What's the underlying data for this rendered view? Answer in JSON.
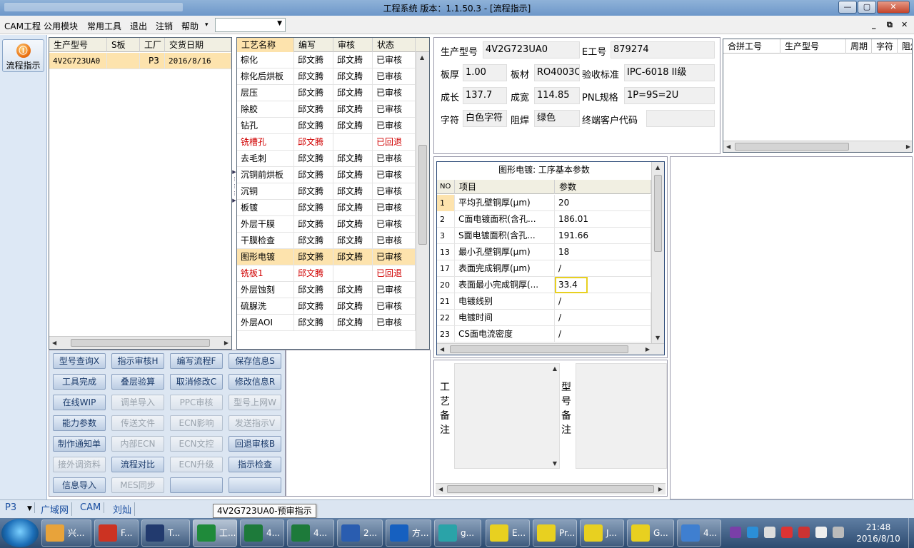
{
  "window": {
    "title": "工程系统    版本：1.1.50.3 - [流程指示]",
    "controls": [
      "—",
      "▢",
      "✕"
    ]
  },
  "menu": {
    "items": [
      "CAM工程",
      "公用模块",
      "常用工具",
      "退出",
      "注销",
      "帮助",
      "▾"
    ],
    "combo_value": "",
    "mdi_controls": [
      "_",
      "⧉",
      "✕"
    ]
  },
  "side": {
    "flow_button": "流程指示",
    "flow_icon": "Ⓘ"
  },
  "orders": {
    "columns": [
      "生产型号",
      "S板",
      "工厂",
      "交货日期"
    ],
    "rows": [
      [
        "4V2G723UA0",
        "",
        "P3",
        "2016/8/16"
      ]
    ]
  },
  "process": {
    "columns": [
      "工艺名称",
      "编写",
      "审核",
      "状态"
    ],
    "rows": [
      [
        "棕化",
        "邱文腾",
        "邱文腾",
        "已审核"
      ],
      [
        "棕化后烘板",
        "邱文腾",
        "邱文腾",
        "已审核"
      ],
      [
        "层压",
        "邱文腾",
        "邱文腾",
        "已审核"
      ],
      [
        "除胶",
        "邱文腾",
        "邱文腾",
        "已审核"
      ],
      [
        "钻孔",
        "邱文腾",
        "邱文腾",
        "已审核"
      ],
      [
        "铣槽孔",
        "邱文腾",
        "",
        "已回退"
      ],
      [
        "去毛刺",
        "邱文腾",
        "邱文腾",
        "已审核"
      ],
      [
        "沉铜前烘板",
        "邱文腾",
        "邱文腾",
        "已审核"
      ],
      [
        "沉铜",
        "邱文腾",
        "邱文腾",
        "已审核"
      ],
      [
        "板镀",
        "邱文腾",
        "邱文腾",
        "已审核"
      ],
      [
        "外层干膜",
        "邱文腾",
        "邱文腾",
        "已审核"
      ],
      [
        "干膜检查",
        "邱文腾",
        "邱文腾",
        "已审核"
      ],
      [
        "图形电镀",
        "邱文腾",
        "邱文腾",
        "已审核"
      ],
      [
        "铣板1",
        "邱文腾",
        "",
        "已回退"
      ],
      [
        "外层蚀刻",
        "邱文腾",
        "邱文腾",
        "已审核"
      ],
      [
        "硫脲洗",
        "邱文腾",
        "邱文腾",
        "已审核"
      ],
      [
        "外层AOI",
        "邱文腾",
        "邱文腾",
        "已审核"
      ]
    ]
  },
  "buttons": [
    [
      "型号查询X",
      "指示审核H",
      "编写流程F",
      "保存信息S"
    ],
    [
      "工具完成",
      "叠层验算",
      "取消修改C",
      "修改信息R"
    ],
    [
      "在线WIP",
      "调单导入",
      "PPC审核",
      "型号上网W"
    ],
    [
      "能力参数",
      "传送文件",
      "ECN影响",
      "发送指示V"
    ],
    [
      "制作通知单",
      "内部ECN",
      "ECN文控",
      "回退审核B"
    ],
    [
      "接外调资料",
      "流程对比",
      "ECN升级",
      "指示检查"
    ],
    [
      "信息导入",
      "MES同步",
      "",
      ""
    ]
  ],
  "info": {
    "part_no_label": "生产型号",
    "part_no": "4V2G723UA0",
    "e_no_label": "E工号",
    "e_no": "879274",
    "thickness_label": "板厚",
    "thickness": "1.00",
    "material_label": "板材",
    "material": "RO4003C",
    "standard_label": "验收标准",
    "standard": "IPC-6018 II级",
    "length_label": "成长",
    "length": "137.7",
    "width_label": "成宽",
    "width": "114.85",
    "pnl_label": "PNL规格",
    "pnl": "1P=9S=2U",
    "legend_label": "字符",
    "legend": "白色字符",
    "mask_label": "阻焊",
    "mask": "绿色",
    "customer_label": "终端客户代码",
    "customer": ""
  },
  "merge": {
    "columns": [
      "合拼工号",
      "生产型号",
      "周期",
      "字符",
      "阻焊"
    ]
  },
  "params": {
    "title": "图形电镀: 工序基本参数",
    "columns": [
      "NO",
      "项目",
      "参数"
    ],
    "rows": [
      [
        "1",
        "平均孔壁铜厚(μm)",
        "20"
      ],
      [
        "2",
        "C面电镀面积(含孔...",
        "186.01"
      ],
      [
        "3",
        "S面电镀面积(含孔...",
        "191.66"
      ],
      [
        "13",
        "最小孔壁铜厚(μm)",
        "18"
      ],
      [
        "17",
        "表面完成铜厚(μm)",
        "/"
      ],
      [
        "20",
        "表面最小完成铜厚(...",
        "33.4"
      ],
      [
        "21",
        "电镀线别",
        "/"
      ],
      [
        "22",
        "电镀时间",
        "/"
      ],
      [
        "23",
        "CS面电流密度",
        "/"
      ]
    ]
  },
  "notes": {
    "process_label": "工艺备注",
    "model_label": "型号备注"
  },
  "statusbar": {
    "factory": "P3",
    "net": "广域网",
    "dept": "CAM",
    "user": "刘灿"
  },
  "tooltip": "4V2G723UA0-预审指示",
  "taskbar": {
    "items": [
      "兴...",
      "F...",
      "T...",
      "工...",
      "4...",
      "4...",
      "2...",
      "方...",
      "g...",
      "E...",
      "Pr...",
      "J...",
      "G...",
      "4..."
    ],
    "time": "21:48",
    "date": "2016/8/10"
  }
}
